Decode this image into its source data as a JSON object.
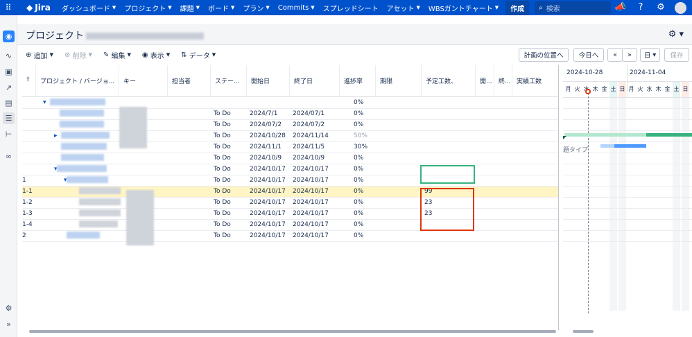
{
  "topnav": {
    "logo": "Jira",
    "items": [
      {
        "label": "ダッシュボード"
      },
      {
        "label": "プロジェクト"
      },
      {
        "label": "課題"
      },
      {
        "label": "ボード"
      },
      {
        "label": "プラン"
      },
      {
        "label": "Commits"
      },
      {
        "label": "スプレッドシート"
      },
      {
        "label": "アセット"
      },
      {
        "label": "WBSガントチャート"
      }
    ],
    "create": "作成",
    "search_placeholder": "検索"
  },
  "header": {
    "title": "プロジェクト"
  },
  "toolbar": {
    "add": "追加",
    "delete": "削除",
    "edit": "編集",
    "view": "表示",
    "data": "データ",
    "plan_position": "計画の位置へ",
    "today": "今日へ",
    "prev": "«",
    "next": "»",
    "scale": "日",
    "save": "保存"
  },
  "columns": {
    "project": "プロジェクト / バージョ...",
    "key": "キー",
    "assignee": "担当者",
    "status": "ステー...",
    "start": "開始日",
    "end": "終了日",
    "progress": "進捗率",
    "due": "期限",
    "estimate": "予定工数、",
    "c_open": "開...",
    "c_end": "終...",
    "actual": "実績工数"
  },
  "rows": [
    {
      "num": "",
      "status": "",
      "start": "",
      "end": "",
      "progress": "0%",
      "estimate": ""
    },
    {
      "num": "",
      "status": "To Do",
      "start": "2024/7/1",
      "end": "2024/07/1",
      "progress": "0%",
      "estimate": ""
    },
    {
      "num": "",
      "status": "To Do",
      "start": "2024/07/2",
      "end": "2024/07/2",
      "progress": "0%",
      "estimate": ""
    },
    {
      "num": "",
      "status": "To Do",
      "start": "2024/10/28",
      "end": "2024/11/14",
      "progress": "50%",
      "estimate": ""
    },
    {
      "num": "",
      "status": "To Do",
      "start": "2024/11/1",
      "end": "2024/11/5",
      "progress": "30%",
      "estimate": ""
    },
    {
      "num": "",
      "status": "To Do",
      "start": "2024/10/9",
      "end": "2024/10/9",
      "progress": "0%",
      "estimate": ""
    },
    {
      "num": "",
      "status": "To Do",
      "start": "2024/10/17",
      "end": "2024/10/17",
      "progress": "0%",
      "estimate": ""
    },
    {
      "num": "1",
      "status": "To Do",
      "start": "2024/10/17",
      "end": "2024/10/17",
      "progress": "0%",
      "estimate": ""
    },
    {
      "num": "1-1",
      "status": "To Do",
      "start": "2024/10/17",
      "end": "2024/10/17",
      "progress": "0%",
      "estimate": "99"
    },
    {
      "num": "1-2",
      "status": "To Do",
      "start": "2024/10/17",
      "end": "2024/10/17",
      "progress": "0%",
      "estimate": "23"
    },
    {
      "num": "1-3",
      "status": "To Do",
      "start": "2024/10/17",
      "end": "2024/10/17",
      "progress": "0%",
      "estimate": "23"
    },
    {
      "num": "1-4",
      "status": "To Do",
      "start": "2024/10/17",
      "end": "2024/10/17",
      "progress": "0%",
      "estimate": ""
    },
    {
      "num": "2",
      "status": "To Do",
      "start": "2024/10/17",
      "end": "2024/10/17",
      "progress": "0%",
      "estimate": ""
    }
  ],
  "gantt": {
    "week1": "2024-10-28",
    "week2": "2024-11-04",
    "days": [
      "月",
      "火",
      "水",
      "木",
      "金",
      "土",
      "日",
      "月",
      "火",
      "水",
      "木",
      "金",
      "土",
      "日"
    ],
    "bar_label": "題タイプ"
  },
  "colors": {
    "nav": "#0052cc",
    "selected_row": "#fff4c4",
    "green_box": "#36b37e",
    "red_box": "#de350b",
    "saturday": "#e6f4f3",
    "sunday": "#ffebe6"
  }
}
